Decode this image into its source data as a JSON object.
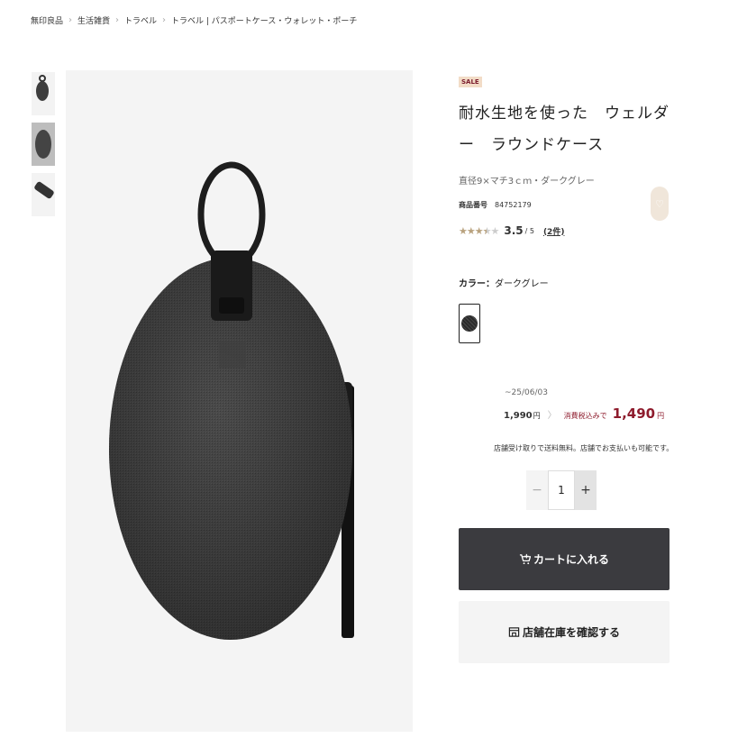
{
  "breadcrumb": {
    "items": [
      "無印良品",
      "生活雑貨",
      "トラベル",
      "トラベル | パスポートケース・ウォレット・ポーチ"
    ]
  },
  "product": {
    "badge": "SALE",
    "title": "耐水生地を使った　ウェルダー　ラウンドケース",
    "subtitle": "直径9×マチ3ｃｍ・ダークグレー",
    "code_label": "商品番号",
    "code_value": "84752179",
    "rating_score": "3.5",
    "rating_max": "/ 5",
    "rating_value": 3.5,
    "review_count": "(2件)"
  },
  "color": {
    "label": "カラー：",
    "value": "ダークグレー"
  },
  "price": {
    "period": "~25/06/03",
    "old_price": "1,990",
    "old_unit": "円",
    "tax_label": "消費税込みで",
    "new_price": "1,490",
    "new_unit": "円",
    "shipping_note": "店舗受け取りで送料無料。店舗でお支払いも可能です。"
  },
  "quantity": {
    "minus": "−",
    "value": "1",
    "plus": "+"
  },
  "actions": {
    "cart_label": "カートに入れる",
    "store_label": "店舗在庫を確認する"
  },
  "icons": {
    "wishlist": "heart-icon",
    "cart": "cart-icon",
    "store": "store-icon"
  },
  "colors": {
    "sale_badge_bg": "#f2dcc7",
    "price_accent": "#8e1b2c",
    "cart_button_bg": "#3b3b3f",
    "wishlist_bg": "#f0e6da"
  }
}
